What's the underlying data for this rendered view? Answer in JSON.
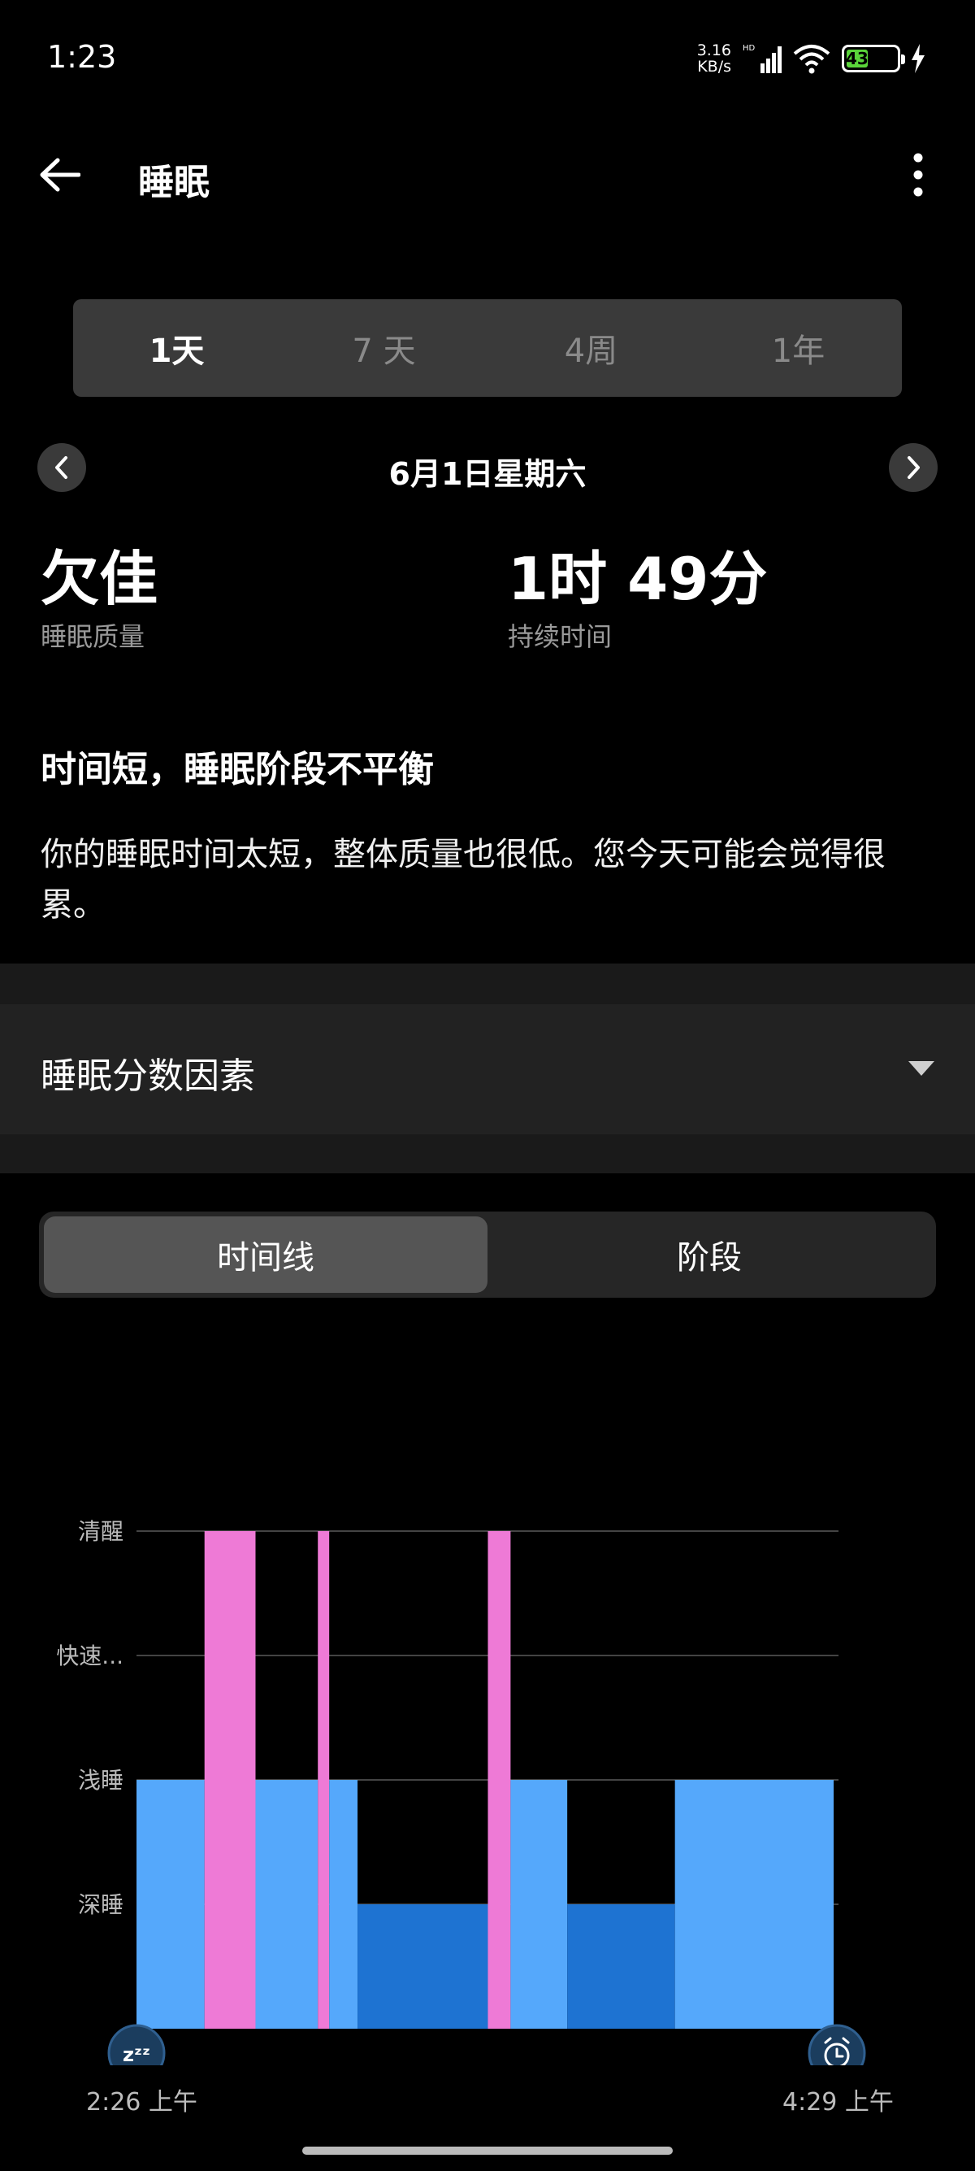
{
  "status_bar": {
    "time": "1:23",
    "net_speed_value": "3.16",
    "net_speed_unit": "KB/s",
    "network_tag": "HD",
    "battery_level": "43",
    "battery_fraction": 0.43
  },
  "header": {
    "title": "睡眠"
  },
  "range_tabs": [
    {
      "label": "1天",
      "active": true
    },
    {
      "label": "7 天",
      "active": false
    },
    {
      "label": "4周",
      "active": false
    },
    {
      "label": "1年",
      "active": false
    }
  ],
  "date_nav": {
    "date": "6月1日星期六"
  },
  "metrics": {
    "quality_value": "欠佳",
    "quality_label": "睡眠质量",
    "duration_value": "1时 49分",
    "duration_label": "持续时间"
  },
  "summary": {
    "title": "时间短，睡眠阶段不平衡",
    "body": "你的睡眠时间太短，整体质量也很低。您今天可能会觉得很累。"
  },
  "factors": {
    "label": "睡眠分数因素"
  },
  "view_toggle": {
    "timeline": "时间线",
    "stages": "阶段"
  },
  "chart_data": {
    "type": "timeline",
    "stage_labels": [
      "清醒",
      "快速...",
      "浅睡",
      "深睡"
    ],
    "start_label": "2:26 上午",
    "end_label": "4:29 上午",
    "x_unit": "minutes since 2:26",
    "colors": {
      "awake": "#ee7ad6",
      "light": "#55a8fb",
      "deep": "#1e73d2",
      "rem": "#9b7cf2",
      "grid": "#444444"
    },
    "segments": [
      {
        "stage": "light",
        "start": 0,
        "end": 12
      },
      {
        "stage": "awake",
        "start": 12,
        "end": 21
      },
      {
        "stage": "light",
        "start": 21,
        "end": 32
      },
      {
        "stage": "awake",
        "start": 32,
        "end": 34
      },
      {
        "stage": "light",
        "start": 34,
        "end": 39
      },
      {
        "stage": "deep",
        "start": 39,
        "end": 62
      },
      {
        "stage": "awake",
        "start": 62,
        "end": 66
      },
      {
        "stage": "light",
        "start": 66,
        "end": 76
      },
      {
        "stage": "deep",
        "start": 76,
        "end": 95
      },
      {
        "stage": "light",
        "start": 95,
        "end": 123
      }
    ],
    "total_minutes": 123
  }
}
